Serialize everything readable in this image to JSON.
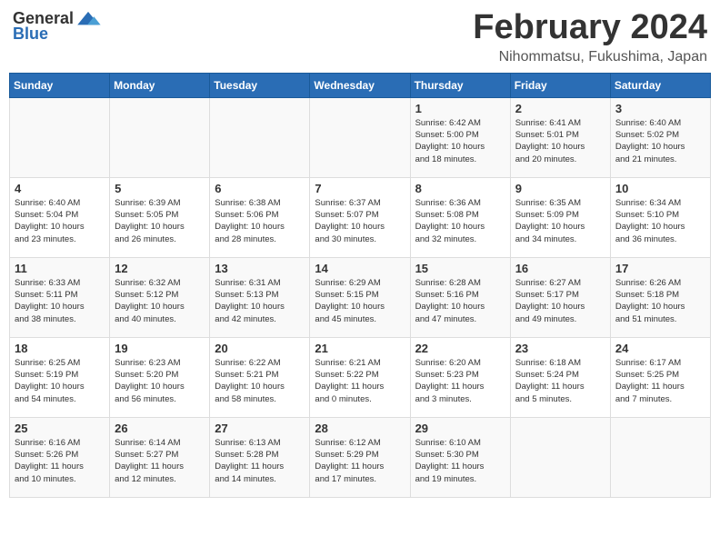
{
  "logo": {
    "general": "General",
    "blue": "Blue"
  },
  "title": "February 2024",
  "subtitle": "Nihommatsu, Fukushima, Japan",
  "days_of_week": [
    "Sunday",
    "Monday",
    "Tuesday",
    "Wednesday",
    "Thursday",
    "Friday",
    "Saturday"
  ],
  "weeks": [
    [
      {
        "day": "",
        "info": ""
      },
      {
        "day": "",
        "info": ""
      },
      {
        "day": "",
        "info": ""
      },
      {
        "day": "",
        "info": ""
      },
      {
        "day": "1",
        "info": "Sunrise: 6:42 AM\nSunset: 5:00 PM\nDaylight: 10 hours\nand 18 minutes."
      },
      {
        "day": "2",
        "info": "Sunrise: 6:41 AM\nSunset: 5:01 PM\nDaylight: 10 hours\nand 20 minutes."
      },
      {
        "day": "3",
        "info": "Sunrise: 6:40 AM\nSunset: 5:02 PM\nDaylight: 10 hours\nand 21 minutes."
      }
    ],
    [
      {
        "day": "4",
        "info": "Sunrise: 6:40 AM\nSunset: 5:04 PM\nDaylight: 10 hours\nand 23 minutes."
      },
      {
        "day": "5",
        "info": "Sunrise: 6:39 AM\nSunset: 5:05 PM\nDaylight: 10 hours\nand 26 minutes."
      },
      {
        "day": "6",
        "info": "Sunrise: 6:38 AM\nSunset: 5:06 PM\nDaylight: 10 hours\nand 28 minutes."
      },
      {
        "day": "7",
        "info": "Sunrise: 6:37 AM\nSunset: 5:07 PM\nDaylight: 10 hours\nand 30 minutes."
      },
      {
        "day": "8",
        "info": "Sunrise: 6:36 AM\nSunset: 5:08 PM\nDaylight: 10 hours\nand 32 minutes."
      },
      {
        "day": "9",
        "info": "Sunrise: 6:35 AM\nSunset: 5:09 PM\nDaylight: 10 hours\nand 34 minutes."
      },
      {
        "day": "10",
        "info": "Sunrise: 6:34 AM\nSunset: 5:10 PM\nDaylight: 10 hours\nand 36 minutes."
      }
    ],
    [
      {
        "day": "11",
        "info": "Sunrise: 6:33 AM\nSunset: 5:11 PM\nDaylight: 10 hours\nand 38 minutes."
      },
      {
        "day": "12",
        "info": "Sunrise: 6:32 AM\nSunset: 5:12 PM\nDaylight: 10 hours\nand 40 minutes."
      },
      {
        "day": "13",
        "info": "Sunrise: 6:31 AM\nSunset: 5:13 PM\nDaylight: 10 hours\nand 42 minutes."
      },
      {
        "day": "14",
        "info": "Sunrise: 6:29 AM\nSunset: 5:15 PM\nDaylight: 10 hours\nand 45 minutes."
      },
      {
        "day": "15",
        "info": "Sunrise: 6:28 AM\nSunset: 5:16 PM\nDaylight: 10 hours\nand 47 minutes."
      },
      {
        "day": "16",
        "info": "Sunrise: 6:27 AM\nSunset: 5:17 PM\nDaylight: 10 hours\nand 49 minutes."
      },
      {
        "day": "17",
        "info": "Sunrise: 6:26 AM\nSunset: 5:18 PM\nDaylight: 10 hours\nand 51 minutes."
      }
    ],
    [
      {
        "day": "18",
        "info": "Sunrise: 6:25 AM\nSunset: 5:19 PM\nDaylight: 10 hours\nand 54 minutes."
      },
      {
        "day": "19",
        "info": "Sunrise: 6:23 AM\nSunset: 5:20 PM\nDaylight: 10 hours\nand 56 minutes."
      },
      {
        "day": "20",
        "info": "Sunrise: 6:22 AM\nSunset: 5:21 PM\nDaylight: 10 hours\nand 58 minutes."
      },
      {
        "day": "21",
        "info": "Sunrise: 6:21 AM\nSunset: 5:22 PM\nDaylight: 11 hours\nand 0 minutes."
      },
      {
        "day": "22",
        "info": "Sunrise: 6:20 AM\nSunset: 5:23 PM\nDaylight: 11 hours\nand 3 minutes."
      },
      {
        "day": "23",
        "info": "Sunrise: 6:18 AM\nSunset: 5:24 PM\nDaylight: 11 hours\nand 5 minutes."
      },
      {
        "day": "24",
        "info": "Sunrise: 6:17 AM\nSunset: 5:25 PM\nDaylight: 11 hours\nand 7 minutes."
      }
    ],
    [
      {
        "day": "25",
        "info": "Sunrise: 6:16 AM\nSunset: 5:26 PM\nDaylight: 11 hours\nand 10 minutes."
      },
      {
        "day": "26",
        "info": "Sunrise: 6:14 AM\nSunset: 5:27 PM\nDaylight: 11 hours\nand 12 minutes."
      },
      {
        "day": "27",
        "info": "Sunrise: 6:13 AM\nSunset: 5:28 PM\nDaylight: 11 hours\nand 14 minutes."
      },
      {
        "day": "28",
        "info": "Sunrise: 6:12 AM\nSunset: 5:29 PM\nDaylight: 11 hours\nand 17 minutes."
      },
      {
        "day": "29",
        "info": "Sunrise: 6:10 AM\nSunset: 5:30 PM\nDaylight: 11 hours\nand 19 minutes."
      },
      {
        "day": "",
        "info": ""
      },
      {
        "day": "",
        "info": ""
      }
    ]
  ]
}
